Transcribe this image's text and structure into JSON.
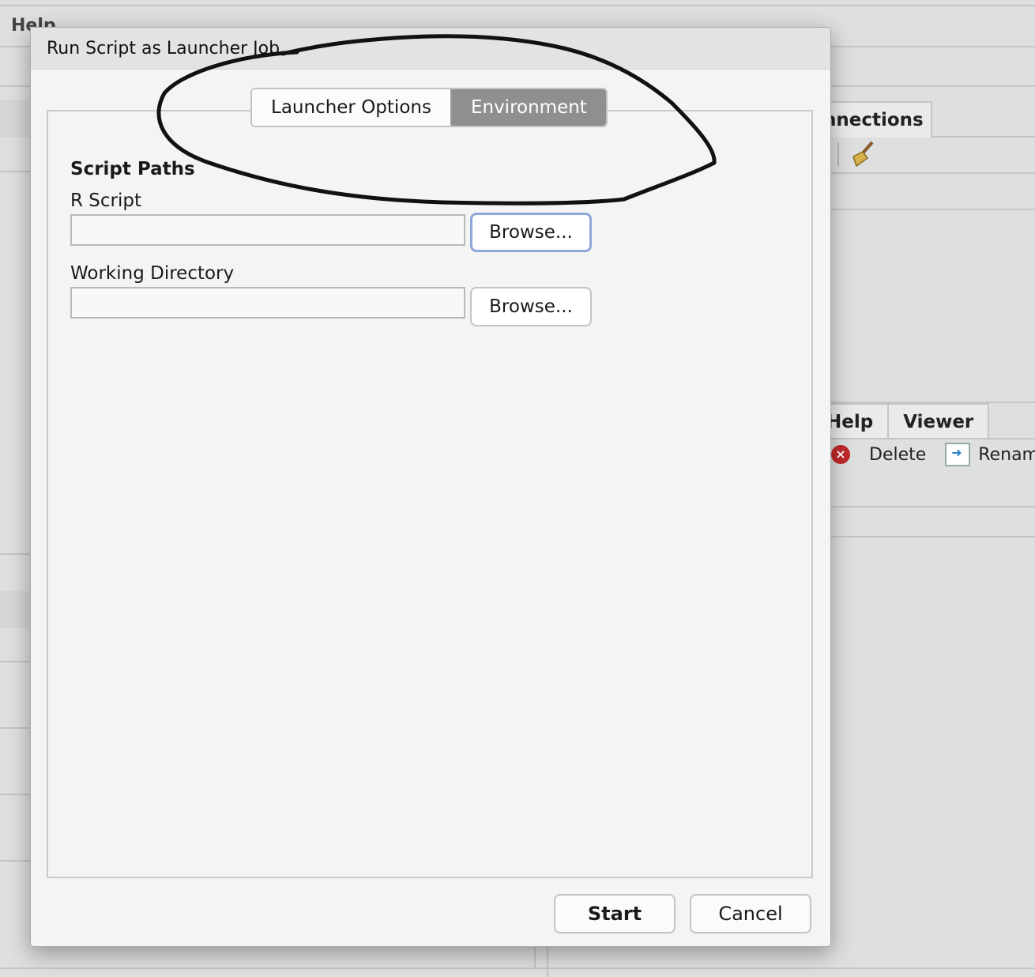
{
  "background": {
    "menu_help": "Help",
    "connections_tab": "nnections",
    "lower_tabs": [
      "Help",
      "Viewer"
    ],
    "files_toolbar": {
      "delete_label": "Delete",
      "rename_label": "Rename"
    }
  },
  "dialog": {
    "title": "Run Script as Launcher Job",
    "tabs": [
      {
        "label": "Launcher Options",
        "active": false
      },
      {
        "label": "Environment",
        "active": true
      }
    ],
    "section_title": "Script Paths",
    "r_script": {
      "label": "R Script",
      "value": "",
      "browse_label": "Browse..."
    },
    "working_directory": {
      "label": "Working Directory",
      "value": "",
      "browse_label": "Browse..."
    },
    "start_label": "Start",
    "cancel_label": "Cancel"
  }
}
